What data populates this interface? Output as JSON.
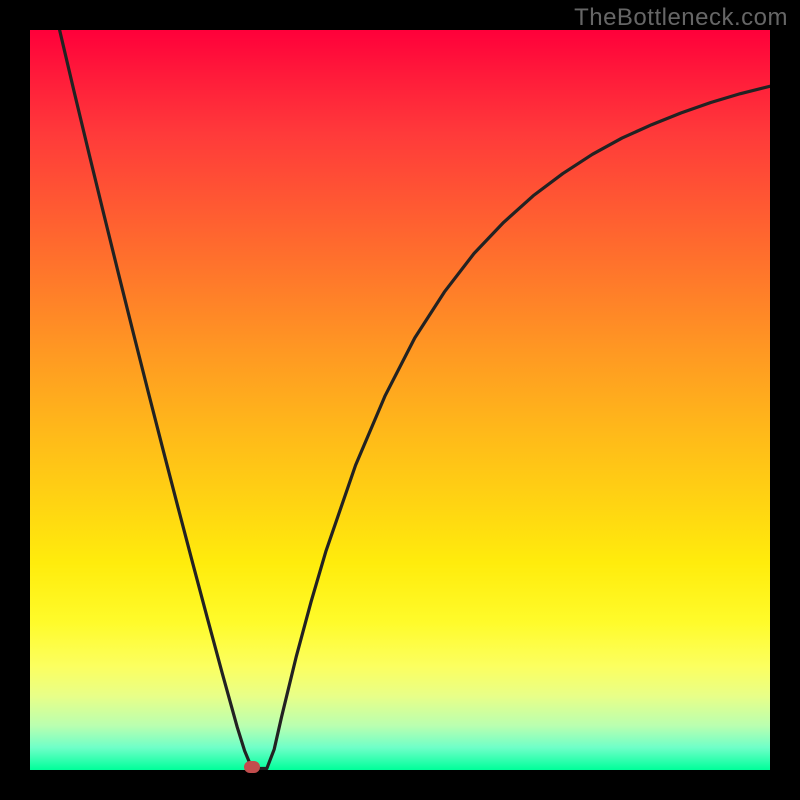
{
  "watermark": "TheBottleneck.com",
  "chart_data": {
    "type": "line",
    "title": "",
    "xlabel": "",
    "ylabel": "",
    "xlim": [
      0,
      100
    ],
    "ylim": [
      0,
      100
    ],
    "grid": false,
    "series": [
      {
        "name": "curve",
        "x": [
          4,
          6,
          8,
          10,
          12,
          14,
          16,
          18,
          20,
          22,
          24,
          26,
          27,
          28,
          29,
          30,
          31,
          32,
          33,
          34,
          36,
          38,
          40,
          44,
          48,
          52,
          56,
          60,
          64,
          68,
          72,
          76,
          80,
          84,
          88,
          92,
          96,
          100
        ],
        "values": [
          100,
          91.5,
          83.2,
          75.0,
          66.9,
          58.9,
          51.0,
          43.2,
          35.5,
          27.9,
          20.4,
          13.0,
          9.4,
          5.8,
          2.6,
          0.2,
          0.2,
          0.2,
          2.8,
          7.2,
          15.4,
          22.8,
          29.6,
          41.2,
          50.6,
          58.4,
          64.6,
          69.8,
          74.0,
          77.6,
          80.6,
          83.2,
          85.4,
          87.2,
          88.8,
          90.2,
          91.4,
          92.4
        ]
      }
    ],
    "marker": {
      "x": 30,
      "y": 0.4
    },
    "colors": {
      "top": "#ff003a",
      "mid": "#ffd412",
      "bottom": "#00ff9a",
      "curve": "#222222",
      "marker": "#c24d4d"
    }
  }
}
